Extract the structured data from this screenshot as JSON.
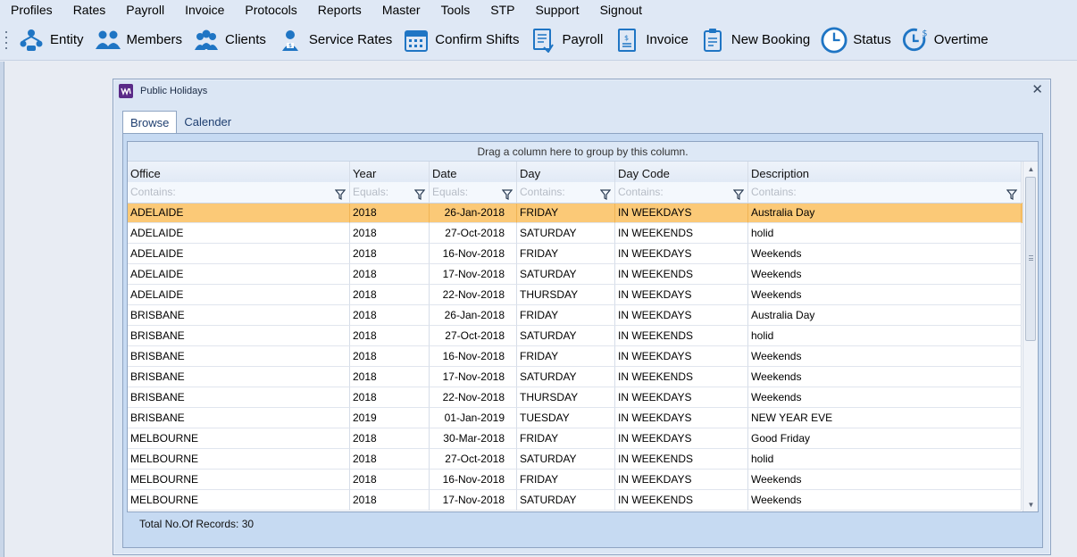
{
  "menu": [
    "Profiles",
    "Rates",
    "Payroll",
    "Invoice",
    "Protocols",
    "Reports",
    "Master",
    "Tools",
    "STP",
    "Support",
    "Signout"
  ],
  "toolbar": [
    {
      "label": "Entity",
      "icon": "entity-icon"
    },
    {
      "label": "Members",
      "icon": "members-icon"
    },
    {
      "label": "Clients",
      "icon": "clients-icon"
    },
    {
      "label": "Service Rates",
      "icon": "service-rates-icon"
    },
    {
      "label": "Confirm Shifts",
      "icon": "calendar-icon"
    },
    {
      "label": "Payroll",
      "icon": "payroll-document-icon"
    },
    {
      "label": "Invoice",
      "icon": "invoice-document-icon"
    },
    {
      "label": "New Booking",
      "icon": "clipboard-icon"
    },
    {
      "label": "Status",
      "icon": "clock-icon"
    },
    {
      "label": "Overtime",
      "icon": "clock-dollar-icon"
    }
  ],
  "dialog": {
    "title": "Public Holidays",
    "tabs": [
      "Browse",
      "Calender"
    ],
    "group_panel": "Drag a column here to group by this column.",
    "columns": [
      "Office",
      "Year",
      "Date",
      "Day",
      "Day Code",
      "Description"
    ],
    "filters": [
      "Contains:",
      "Equals:",
      "Equals:",
      "Contains:",
      "Contains:",
      "Contains:"
    ],
    "rows": [
      [
        "ADELAIDE",
        "2018",
        "26-Jan-2018",
        "FRIDAY",
        "IN WEEKDAYS",
        "Australia Day"
      ],
      [
        "ADELAIDE",
        "2018",
        "27-Oct-2018",
        "SATURDAY",
        "IN WEEKENDS",
        "holid"
      ],
      [
        "ADELAIDE",
        "2018",
        "16-Nov-2018",
        "FRIDAY",
        "IN WEEKDAYS",
        "Weekends"
      ],
      [
        "ADELAIDE",
        "2018",
        "17-Nov-2018",
        "SATURDAY",
        "IN WEEKENDS",
        "Weekends"
      ],
      [
        "ADELAIDE",
        "2018",
        "22-Nov-2018",
        "THURSDAY",
        "IN WEEKDAYS",
        "Weekends"
      ],
      [
        "BRISBANE",
        "2018",
        "26-Jan-2018",
        "FRIDAY",
        "IN WEEKDAYS",
        "Australia Day"
      ],
      [
        "BRISBANE",
        "2018",
        "27-Oct-2018",
        "SATURDAY",
        "IN WEEKENDS",
        "holid"
      ],
      [
        "BRISBANE",
        "2018",
        "16-Nov-2018",
        "FRIDAY",
        "IN WEEKDAYS",
        "Weekends"
      ],
      [
        "BRISBANE",
        "2018",
        "17-Nov-2018",
        "SATURDAY",
        "IN WEEKENDS",
        "Weekends"
      ],
      [
        "BRISBANE",
        "2018",
        "22-Nov-2018",
        "THURSDAY",
        "IN WEEKDAYS",
        "Weekends"
      ],
      [
        "BRISBANE",
        "2019",
        "01-Jan-2019",
        "TUESDAY",
        "IN WEEKDAYS",
        "NEW YEAR EVE"
      ],
      [
        "MELBOURNE",
        "2018",
        "30-Mar-2018",
        "FRIDAY",
        "IN WEEKDAYS",
        "Good Friday"
      ],
      [
        "MELBOURNE",
        "2018",
        "27-Oct-2018",
        "SATURDAY",
        "IN WEEKENDS",
        "holid"
      ],
      [
        "MELBOURNE",
        "2018",
        "16-Nov-2018",
        "FRIDAY",
        "IN WEEKDAYS",
        "Weekends"
      ],
      [
        "MELBOURNE",
        "2018",
        "17-Nov-2018",
        "SATURDAY",
        "IN WEEKENDS",
        "Weekends"
      ]
    ],
    "selected_row": 0,
    "footer": "Total No.Of Records: 30"
  },
  "colors": {
    "accent": "#1f75c4",
    "selection": "#fbc977",
    "app_icon": "#5a2a87"
  }
}
